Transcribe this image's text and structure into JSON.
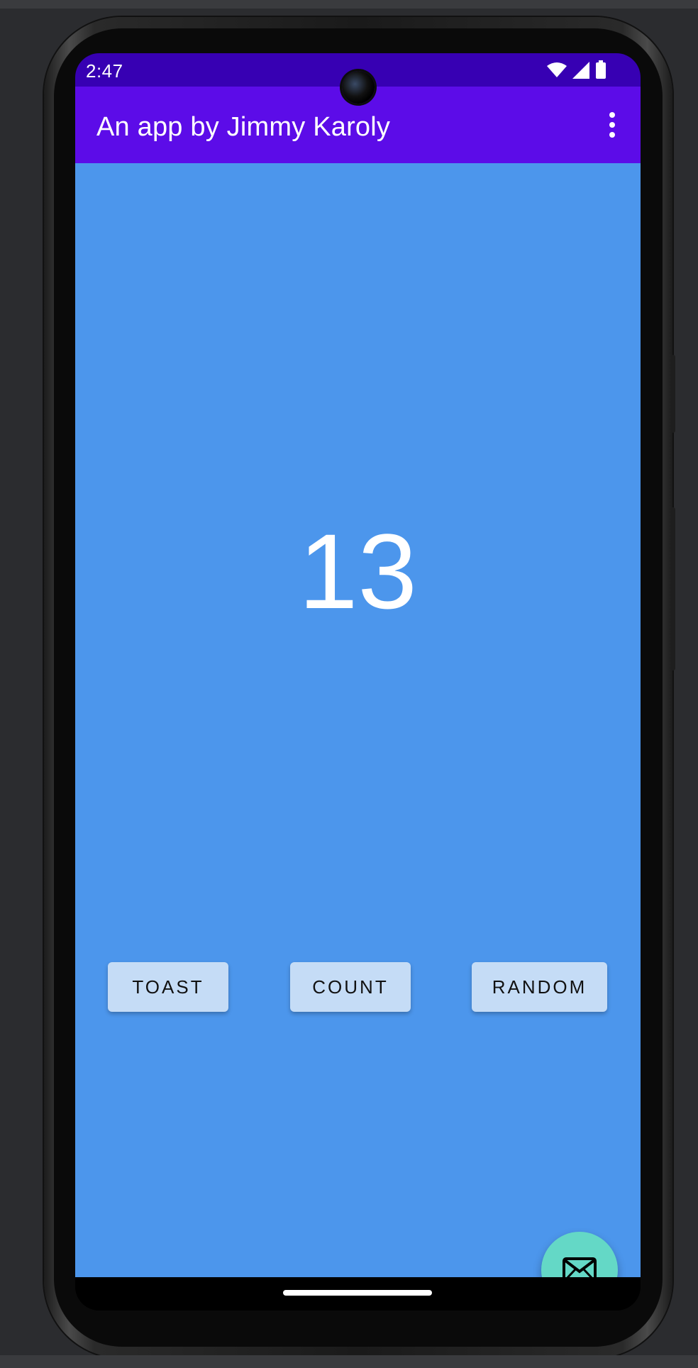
{
  "status_bar": {
    "time": "2:47",
    "icons": [
      "wifi-icon",
      "signal-icon",
      "battery-icon"
    ]
  },
  "app_bar": {
    "title": "An app by Jimmy Karoly",
    "menu_icon": "more-vert-icon"
  },
  "main": {
    "count": "13",
    "buttons": {
      "toast": "TOAST",
      "count": "COUNT",
      "random": "RANDOM"
    },
    "fab_icon": "mail-icon"
  },
  "colors": {
    "status_bar": "#3700b3",
    "app_bar": "#5c0ce8",
    "background": "#4c96ec",
    "button": "#c5dcf6",
    "fab": "#64d8c6"
  }
}
